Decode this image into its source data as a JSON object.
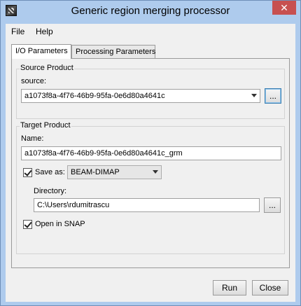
{
  "window": {
    "title": "Generic region merging processor",
    "close_glyph": "✕"
  },
  "menu": {
    "items": [
      "File",
      "Help"
    ]
  },
  "tabs": [
    {
      "label": "I/O Parameters",
      "active": true
    },
    {
      "label": "Processing Parameters",
      "active": false
    }
  ],
  "source_product": {
    "legend": "Source Product",
    "source_label": "source:",
    "source_value": "a1073f8a-4f76-46b9-95fa-0e6d80a4641c",
    "browse_label": "..."
  },
  "target_product": {
    "legend": "Target Product",
    "name_label": "Name:",
    "name_value": "a1073f8a-4f76-46b9-95fa-0e6d80a4641c_grm",
    "save_as_label": "Save as:",
    "save_as_checked": true,
    "format_value": "BEAM-DIMAP",
    "directory_label": "Directory:",
    "directory_value": "C:\\Users\\rdumitrascu",
    "directory_browse_label": "...",
    "open_in_snap_label": "Open in SNAP",
    "open_in_snap_checked": true
  },
  "footer": {
    "run_label": "Run",
    "close_label": "Close"
  },
  "colors": {
    "titlebar": "#aecbed",
    "close_button": "#c75050",
    "panel": "#f0f0f0"
  }
}
